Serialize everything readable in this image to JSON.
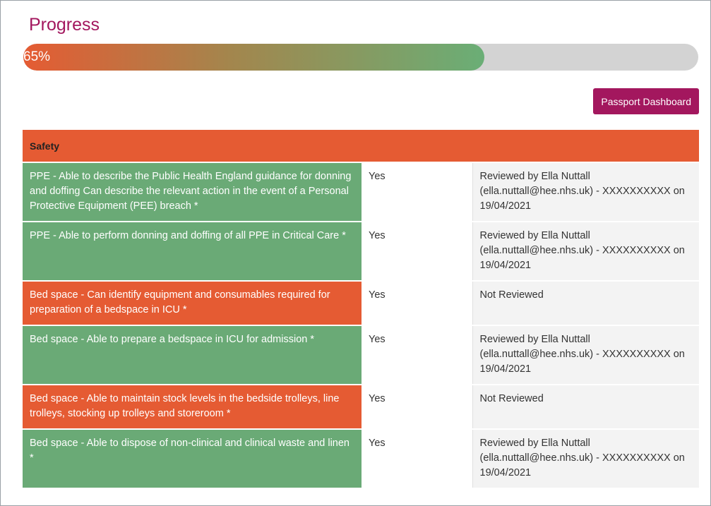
{
  "progress": {
    "title": "Progress",
    "percent_label": "65%",
    "fraction": 0.65,
    "fill_color_start": "#e55b33",
    "fill_color_end": "#6aae76"
  },
  "toolbar": {
    "dashboard_label": "Passport Dashboard"
  },
  "section": {
    "title": "Safety",
    "rows": [
      {
        "criterion": "PPE - Able to describe the Public Health England guidance for donning and doffing Can describe the relevant action in the event of a Personal Protective Equipment (PEE) breach *",
        "answer": "Yes",
        "review": "Reviewed by Ella Nuttall (ella.nuttall@hee.nhs.uk) - XXXXXXXXXX on 19/04/2021",
        "status": "green"
      },
      {
        "criterion": "PPE - Able to perform donning and doffing of all PPE in Critical Care *",
        "answer": "Yes",
        "review": "Reviewed by Ella Nuttall (ella.nuttall@hee.nhs.uk) - XXXXXXXXXX on 19/04/2021",
        "status": "green"
      },
      {
        "criterion": "Bed space - Can identify equipment and consumables required for preparation of a bedspace in ICU *",
        "answer": "Yes",
        "review": "Not Reviewed",
        "status": "red"
      },
      {
        "criterion": "Bed space - Able to prepare a bedspace in ICU for admission *",
        "answer": "Yes",
        "review": "Reviewed by Ella Nuttall (ella.nuttall@hee.nhs.uk) - XXXXXXXXXX on 19/04/2021",
        "status": "green"
      },
      {
        "criterion": "Bed space - Able to maintain stock levels in the bedside trolleys, line trolleys, stocking up trolleys and storeroom *",
        "answer": "Yes",
        "review": "Not Reviewed",
        "status": "red"
      },
      {
        "criterion": "Bed space - Able to dispose of non-clinical and clinical waste and linen *",
        "answer": "Yes",
        "review": "Reviewed by Ella Nuttall (ella.nuttall@hee.nhs.uk) - XXXXXXXXXX on 19/04/2021",
        "status": "green"
      }
    ]
  }
}
